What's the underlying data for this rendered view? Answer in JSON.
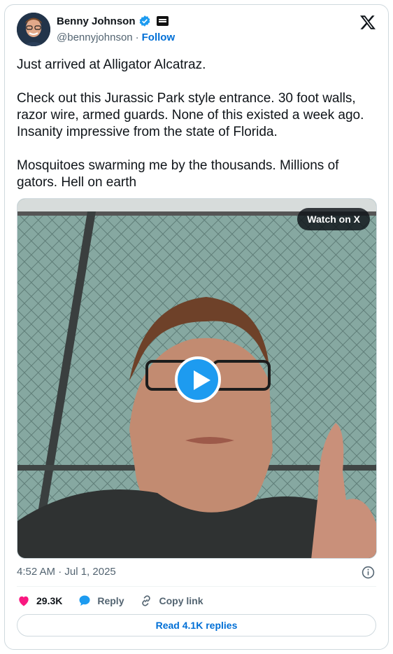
{
  "author": {
    "name": "Benny Johnson",
    "handle": "@bennyjohnson",
    "separator": "·",
    "follow_label": "Follow"
  },
  "post": {
    "text": "Just arrived at Alligator Alcatraz.\n\nCheck out this Jurassic Park style entrance. 30 foot walls,\nrazor wire, armed guards. None of this existed a week ago.\nInsanity impressive from the state of Florida.\n\nMosquitoes swarming me by the thousands. Millions of\ngators. Hell on earth",
    "timestamp": "4:52 AM · Jul 1, 2025"
  },
  "media": {
    "watch_label": "Watch on X"
  },
  "actions": {
    "likes": "29.3K",
    "reply_label": "Reply",
    "copy_label": "Copy link",
    "read_replies_label": "Read 4.1K replies"
  },
  "colors": {
    "accent": "#1d9bf0",
    "like": "#f91880",
    "link": "#006fd6"
  }
}
